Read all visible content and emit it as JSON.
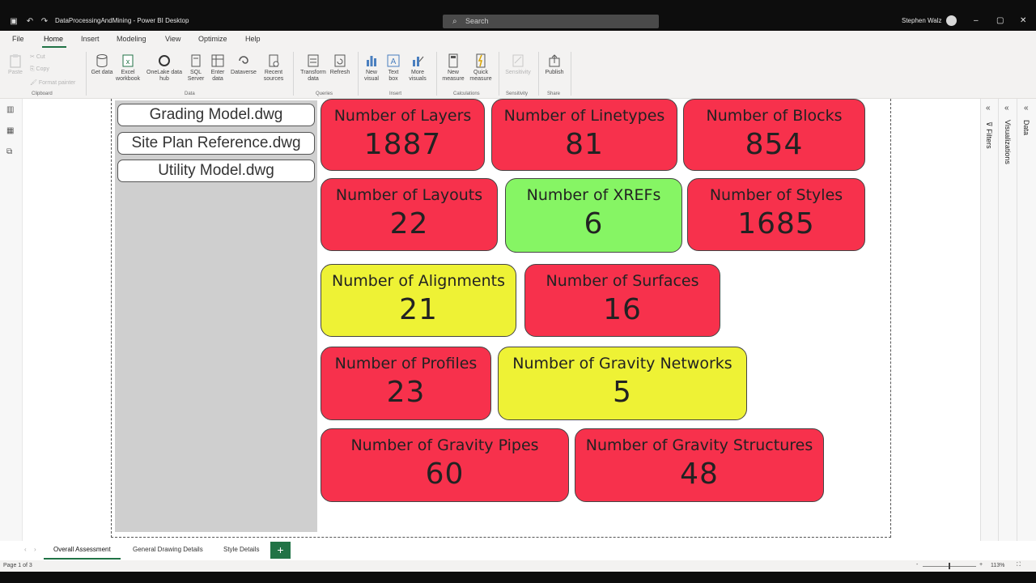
{
  "window": {
    "doc_title": "DataProcessingAndMining - Power BI Desktop",
    "search_placeholder": "Search",
    "user_name": "Stephen Walz"
  },
  "menu": [
    "File",
    "Home",
    "Insert",
    "Modeling",
    "View",
    "Optimize",
    "Help"
  ],
  "ribbon": {
    "clipboard": {
      "paste": "Paste",
      "cut": "Cut",
      "copy": "Copy",
      "format_painter": "Format painter",
      "group": "Clipboard"
    },
    "data": {
      "get_data": "Get data",
      "excel": "Excel workbook",
      "onelake": "OneLake data hub",
      "sql": "SQL Server",
      "enter": "Enter data",
      "dataverse": "Dataverse",
      "recent": "Recent sources",
      "group": "Data"
    },
    "queries": {
      "transform": "Transform data",
      "refresh": "Refresh",
      "group": "Queries"
    },
    "insert": {
      "new_visual": "New visual",
      "text_box": "Text box",
      "more_visuals": "More visuals",
      "group": "Insert"
    },
    "calculations": {
      "new_measure": "New measure",
      "quick_measure": "Quick measure",
      "group": "Calculations"
    },
    "sensitivity": {
      "label": "Sensitivity",
      "group": "Sensitivity"
    },
    "share": {
      "publish": "Publish",
      "group": "Share"
    }
  },
  "files": [
    "Grading Model.dwg",
    "Site Plan Reference.dwg",
    "Utility Model.dwg"
  ],
  "colors": {
    "red": "#f7314c",
    "green": "#86f564",
    "yellow": "#eef235",
    "accent": "#217346"
  },
  "cards": [
    {
      "label": "Number of Layers",
      "value": "1887",
      "status": "red"
    },
    {
      "label": "Number of Linetypes",
      "value": "81",
      "status": "red"
    },
    {
      "label": "Number of Blocks",
      "value": "854",
      "status": "red"
    },
    {
      "label": "Number of Layouts",
      "value": "22",
      "status": "red"
    },
    {
      "label": "Number of XREFs",
      "value": "6",
      "status": "green"
    },
    {
      "label": "Number of Styles",
      "value": "1685",
      "status": "red"
    },
    {
      "label": "Number of Alignments",
      "value": "21",
      "status": "yellow"
    },
    {
      "label": "Number of Surfaces",
      "value": "16",
      "status": "red"
    },
    {
      "label": "Number of Profiles",
      "value": "23",
      "status": "red"
    },
    {
      "label": "Number of Gravity Networks",
      "value": "5",
      "status": "yellow"
    },
    {
      "label": "Number of Gravity Pipes",
      "value": "60",
      "status": "red"
    },
    {
      "label": "Number of Gravity Structures",
      "value": "48",
      "status": "red"
    }
  ],
  "panes": {
    "filters": "Filters",
    "visualizations": "Visualizations",
    "data": "Data"
  },
  "tabs": [
    "Overall Assessment",
    "General Drawing Details",
    "Style Details"
  ],
  "status": {
    "page": "Page 1 of 3",
    "zoom": "113%"
  }
}
